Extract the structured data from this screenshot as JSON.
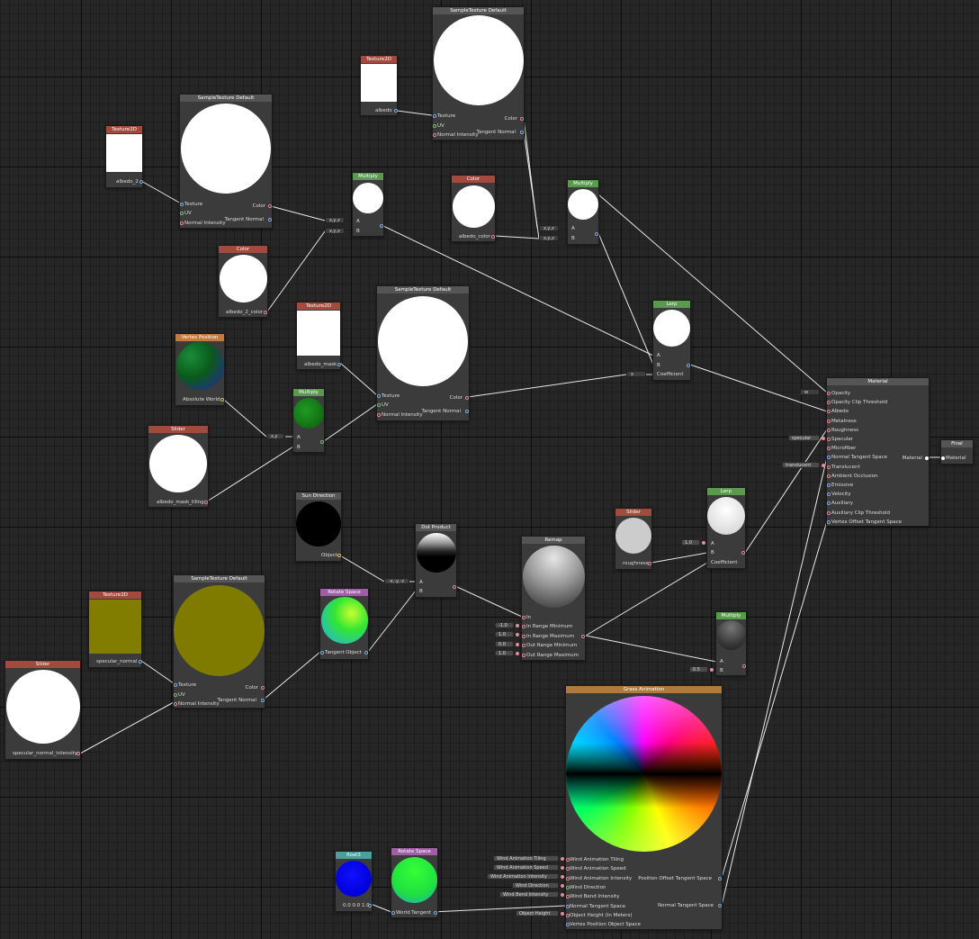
{
  "nodes": {
    "tex_albedo2": {
      "title": "Texture2D",
      "label": "albedo_2"
    },
    "sample1": {
      "title": "SampleTexture Default",
      "in_texture": "Texture",
      "in_uv": "UV",
      "in_normal": "Normal Intensity",
      "out_color": "Color",
      "out_tangent": "Tangent Normal"
    },
    "tex_albedo": {
      "title": "Texture2D",
      "label": "albedo"
    },
    "sample2": {
      "title": "SampleTexture Default",
      "in_texture": "Texture",
      "in_uv": "UV",
      "in_normal": "Normal Intensity",
      "out_color": "Color",
      "out_tangent": "Tangent Normal"
    },
    "multiply1": {
      "title": "Multiply",
      "in_a": "A",
      "in_b": "B"
    },
    "color_albedo": {
      "title": "Color",
      "label": "albedo_color"
    },
    "multiply2": {
      "title": "Multiply",
      "in_a": "A",
      "in_b": "B"
    },
    "color_albedo2": {
      "title": "Color",
      "label": "albedo_2_color"
    },
    "tex_mask": {
      "title": "Texture2D",
      "label": "albedo_mask"
    },
    "sample3": {
      "title": "SampleTexture Default",
      "in_texture": "Texture",
      "in_uv": "UV",
      "in_normal": "Normal Intensity",
      "out_color": "Color",
      "out_tangent": "Tangent Normal"
    },
    "vertex_pos": {
      "title": "Vertex Position",
      "label": "Absolute World"
    },
    "multiply3": {
      "title": "Multiply",
      "in_a": "A",
      "in_b": "B"
    },
    "lerp1": {
      "title": "Lerp",
      "in_a": "A",
      "in_b": "B",
      "in_coef": "Coefficient"
    },
    "slider_mask": {
      "title": "Slider",
      "label": "albedo_mask_tiling"
    },
    "material": {
      "title": "Material",
      "inputs": [
        "Opacity",
        "Opacity Clip Threshold",
        "Albedo",
        "Metalness",
        "Roughness",
        "Specular",
        "Microfiber",
        "Normal Tangent Space",
        "Translucent",
        "Ambient Occlusion",
        "Emissive",
        "Velocity",
        "Auxiliary",
        "Auxiliary Clip Threshold",
        "Vertex Offset Tangent Space"
      ],
      "output": "Material"
    },
    "final": {
      "title": "Final",
      "input": "Material"
    },
    "sun_dir": {
      "title": "Sun Direction",
      "label": "Object"
    },
    "dot": {
      "title": "Dot Product",
      "in_a": "A",
      "in_b": "B"
    },
    "remap": {
      "title": "Remap",
      "inputs": [
        "In",
        "In Range Minimum",
        "In Range Maximum",
        "Out Range Minimum",
        "Out Range Maximum"
      ]
    },
    "slider_rough": {
      "title": "Slider",
      "label": "roughness"
    },
    "lerp2": {
      "title": "Lerp",
      "in_a": "A",
      "in_b": "B",
      "in_coef": "Coefficient"
    },
    "tex_specular": {
      "title": "Texture2D",
      "label": "specular_normal"
    },
    "sample4": {
      "title": "SampleTexture Default",
      "in_texture": "Texture",
      "in_uv": "UV",
      "in_normal": "Normal Intensity",
      "out_color": "Color",
      "out_tangent": "Tangent Normal"
    },
    "rotate1": {
      "title": "Rotate Space",
      "in": "Tangent",
      "out": "Object"
    },
    "slider_spec": {
      "title": "Slider",
      "label": "specular_normal_intensity"
    },
    "multiply4": {
      "title": "Multiply",
      "in_a": "A",
      "in_b": "B"
    },
    "grass": {
      "title": "Grass Animation",
      "inputs": [
        "Wind Animation Tiling",
        "Wind Animation Speed",
        "Wind Animation Intensity",
        "Wind Direction",
        "Wind Bend Intensity",
        "Normal Tangent Space",
        "Object Height (In Meters)",
        "Vertex Position Object Space"
      ],
      "out_pos": "Position Offset Tangent Space",
      "out_norm": "Normal Tangent Space"
    },
    "float3": {
      "title": "float3",
      "label": "0.0 0.0 1.0"
    },
    "rotate2": {
      "title": "Rotate Space",
      "in": "World",
      "out": "Tangent"
    }
  },
  "inline_values": {
    "specular": "specular",
    "translucent": "translucent",
    "lerp2_a": "1.0",
    "remap_min": "-1.0",
    "remap_max": "1.0",
    "remap_out_min": "0.0",
    "remap_out_max": "1.0",
    "mult4_b": "0.5",
    "grass_tiling": "Wind Animation Tiling",
    "grass_speed": "Wind Animation Speed",
    "grass_intensity": "Wind Animation Intensity",
    "grass_dir": "Wind Direction",
    "grass_bend": "Wind Bend Intensity",
    "grass_height": "Object Height"
  },
  "converters": {
    "xyz1": "x,y,z",
    "xyz2": "x,y,z",
    "xyz3": "x,y,z",
    "xyz4": "x,y,z",
    "xy": "x,y",
    "x": "x",
    "w": "w",
    "neg": "-x,-y,-z"
  },
  "colors": {
    "background": "#262626",
    "node": "#3b3b3b",
    "header_grey": "#555555",
    "header_red": "#a34a3e",
    "header_green": "#5a9a4e",
    "header_orange": "#c37a3c",
    "header_purple": "#a05ea8",
    "header_teal": "#4a9f9f",
    "wire": "#e6e6e6"
  }
}
